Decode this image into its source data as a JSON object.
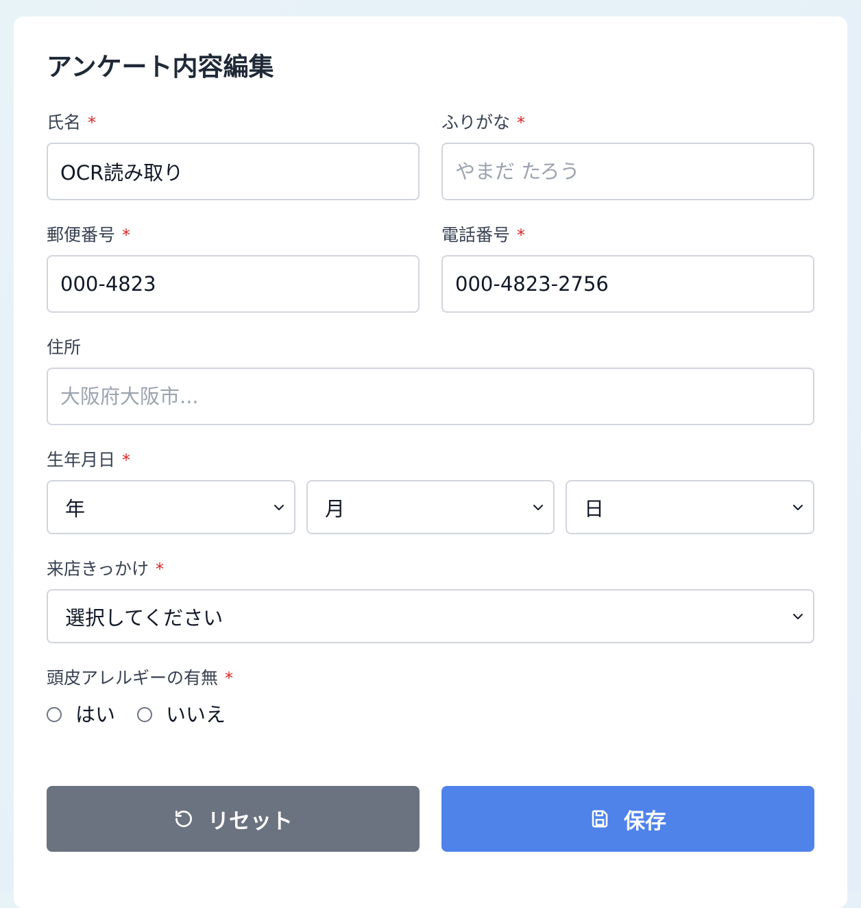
{
  "form": {
    "title": "アンケート内容編集",
    "required_mark": "*"
  },
  "fields": {
    "name": {
      "label": "氏名",
      "value": "OCR読み取り",
      "placeholder": ""
    },
    "furigana": {
      "label": "ふりがな",
      "value": "",
      "placeholder": "やまだ たろう"
    },
    "postal": {
      "label": "郵便番号",
      "value": "000-4823",
      "placeholder": ""
    },
    "phone": {
      "label": "電話番号",
      "value": "000-4823-2756",
      "placeholder": ""
    },
    "address": {
      "label": "住所",
      "value": "",
      "placeholder": "大阪府大阪市..."
    },
    "birthdate": {
      "label": "生年月日",
      "year": "年",
      "month": "月",
      "day": "日"
    },
    "visit_reason": {
      "label": "来店きっかけ",
      "selected": "選択してください"
    },
    "allergy": {
      "label": "頭皮アレルギーの有無",
      "options": [
        "はい",
        "いいえ"
      ]
    }
  },
  "buttons": {
    "reset_label": "リセット",
    "save_label": "保存"
  },
  "icons": {
    "reset": "rotate-ccw-icon",
    "save": "save-icon",
    "dropdown": "chevron-down-icon"
  },
  "colors": {
    "required": "#dc2626",
    "reset_button": "#6b7280",
    "save_button": "#4f83ea",
    "border": "#d1d5db"
  }
}
